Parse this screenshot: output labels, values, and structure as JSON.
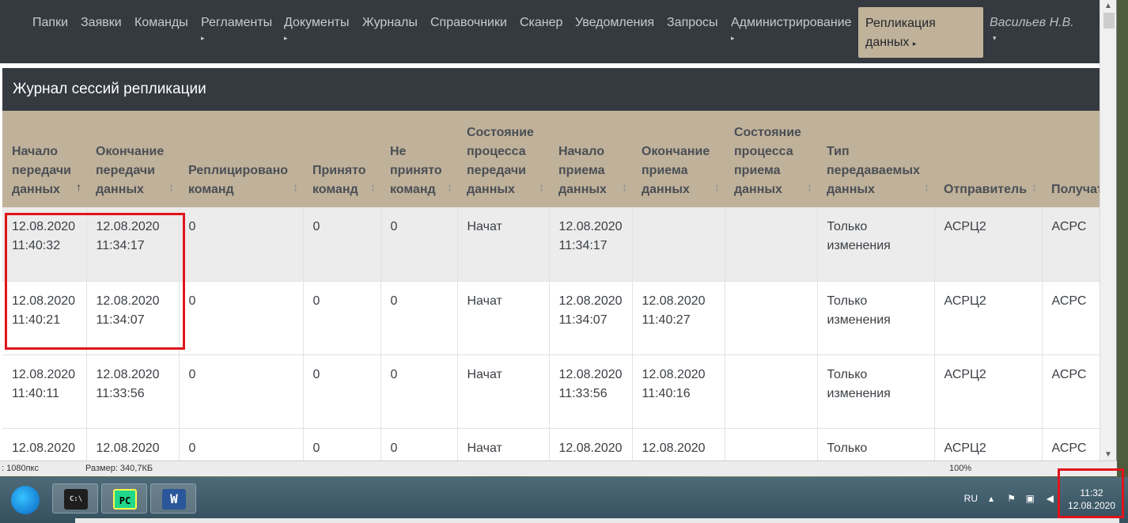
{
  "nav": {
    "items": [
      {
        "label": "Папки",
        "caret": false
      },
      {
        "label": "Заявки",
        "caret": false
      },
      {
        "label": "Команды",
        "caret": false
      },
      {
        "label": "Регламенты",
        "caret": true
      },
      {
        "label": "Документы",
        "caret": true
      },
      {
        "label": "Журналы",
        "caret": false
      },
      {
        "label": "Справочники",
        "caret": false
      },
      {
        "label": "Сканер",
        "caret": false
      },
      {
        "label": "Уведомления",
        "caret": false
      },
      {
        "label": "Запросы",
        "caret": false
      },
      {
        "label": "Администрирование",
        "caret": true
      }
    ],
    "active": {
      "line1": "Репликация",
      "line2": "данных",
      "caret": "▸"
    },
    "user": "Васильев Н.В.",
    "caret_char": "▸",
    "user_caret": "▾"
  },
  "page": {
    "title": "Журнал сессий репликации"
  },
  "table": {
    "headers": [
      {
        "label": "Начало передачи данных",
        "sort": "↑"
      },
      {
        "label": "Окончание передачи данных",
        "sort": "↕"
      },
      {
        "label": "Реплицировано команд",
        "sort": "↕"
      },
      {
        "label": "Принято команд",
        "sort": "↕"
      },
      {
        "label": "Не принято команд",
        "sort": "↕"
      },
      {
        "label": "Состояние процесса передачи данных",
        "sort": "↕"
      },
      {
        "label": "Начало приема данных",
        "sort": "↕"
      },
      {
        "label": "Окончание приема данных",
        "sort": "↕"
      },
      {
        "label": "Состояние процесса приема данных",
        "sort": "↕"
      },
      {
        "label": "Тип передаваемых данных",
        "sort": "↕"
      },
      {
        "label": "Отправитель",
        "sort": "↕"
      },
      {
        "label": "Получатель",
        "sort": ""
      }
    ],
    "rows": [
      [
        "12.08.2020 11:40:32",
        "12.08.2020 11:34:17",
        "0",
        "0",
        "0",
        "Начат",
        "12.08.2020 11:34:17",
        "",
        "",
        "Только изменения",
        "АСРЦ2",
        "АСРС"
      ],
      [
        "12.08.2020 11:40:21",
        "12.08.2020 11:34:07",
        "0",
        "0",
        "0",
        "Начат",
        "12.08.2020 11:34:07",
        "12.08.2020 11:40:27",
        "",
        "Только изменения",
        "АСРЦ2",
        "АСРС"
      ],
      [
        "12.08.2020 11:40:11",
        "12.08.2020 11:33:56",
        "0",
        "0",
        "0",
        "Начат",
        "12.08.2020 11:33:56",
        "12.08.2020 11:40:16",
        "",
        "Только изменения",
        "АСРЦ2",
        "АСРС"
      ],
      [
        "12.08.2020",
        "12.08.2020",
        "0",
        "0",
        "0",
        "Начат",
        "12.08.2020",
        "12.08.2020",
        "",
        "Только",
        "АСРЦ2",
        "АСРС"
      ]
    ]
  },
  "statusbar": {
    "dims": ": 1080пкс",
    "size": "Размер: 340,7КБ",
    "zoom": "100%"
  },
  "taskbar": {
    "apps": [
      {
        "name": "cmd-icon",
        "glyph": "C:\\"
      },
      {
        "name": "pycharm-icon",
        "glyph": "PC"
      },
      {
        "name": "word-icon",
        "glyph": "W"
      }
    ],
    "lang": "RU",
    "time": "11:32",
    "date": "12.08.2020"
  },
  "colors": {
    "nav_bg": "#343a40",
    "header_bg": "#c0b19a",
    "highlight": "#e0141b"
  }
}
